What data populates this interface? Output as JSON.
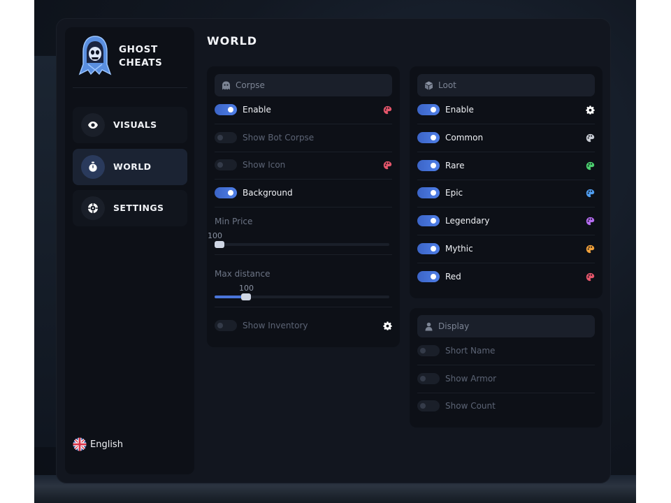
{
  "brand": {
    "line1": "GHOST",
    "line2": "CHEATS"
  },
  "nav": [
    {
      "label": "VISUALS",
      "icon": "eye-icon"
    },
    {
      "label": "WORLD",
      "icon": "stopwatch-icon"
    },
    {
      "label": "SETTINGS",
      "icon": "crosshair-icon"
    }
  ],
  "active_nav": "WORLD",
  "language": {
    "label": "English",
    "icon": "uk-flag-icon"
  },
  "page_title": "WORLD",
  "corpse": {
    "title": "Corpse",
    "icon": "ghost-icon",
    "enable": {
      "label": "Enable",
      "on": true,
      "icon": "palette-icon",
      "color": "#e5566b"
    },
    "show_bot_corpse": {
      "label": "Show Bot Corpse",
      "on": false
    },
    "show_icon": {
      "label": "Show Icon",
      "on": false,
      "icon": "palette-icon",
      "color": "#e5566b"
    },
    "background": {
      "label": "Background",
      "on": true
    },
    "min_price": {
      "label": "Min Price",
      "value": "100",
      "fraction": 0.0
    },
    "max_distance": {
      "label": "Max distance",
      "value": "100",
      "fraction": 0.18
    },
    "show_inventory": {
      "label": "Show Inventory",
      "on": false,
      "icon": "gear-icon"
    }
  },
  "loot": {
    "title": "Loot",
    "icon": "cube-icon",
    "enable": {
      "label": "Enable",
      "on": true,
      "icon": "gear-icon"
    },
    "rarities": [
      {
        "label": "Common",
        "on": true,
        "color": "#c8ccd4"
      },
      {
        "label": "Rare",
        "on": true,
        "color": "#4ccf6f"
      },
      {
        "label": "Epic",
        "on": true,
        "color": "#4f9df0"
      },
      {
        "label": "Legendary",
        "on": true,
        "color": "#b56cf0"
      },
      {
        "label": "Mythic",
        "on": true,
        "color": "#f0a03a"
      },
      {
        "label": "Red",
        "on": true,
        "color": "#e5566b"
      }
    ]
  },
  "display": {
    "title": "Display",
    "icon": "person-icon",
    "items": [
      {
        "label": "Short Name",
        "on": false
      },
      {
        "label": "Show Armor",
        "on": false
      },
      {
        "label": "Show Count",
        "on": false
      }
    ]
  },
  "colors": {
    "accent": "#4a75da",
    "panel": "#12161f",
    "card": "#0d1017"
  }
}
